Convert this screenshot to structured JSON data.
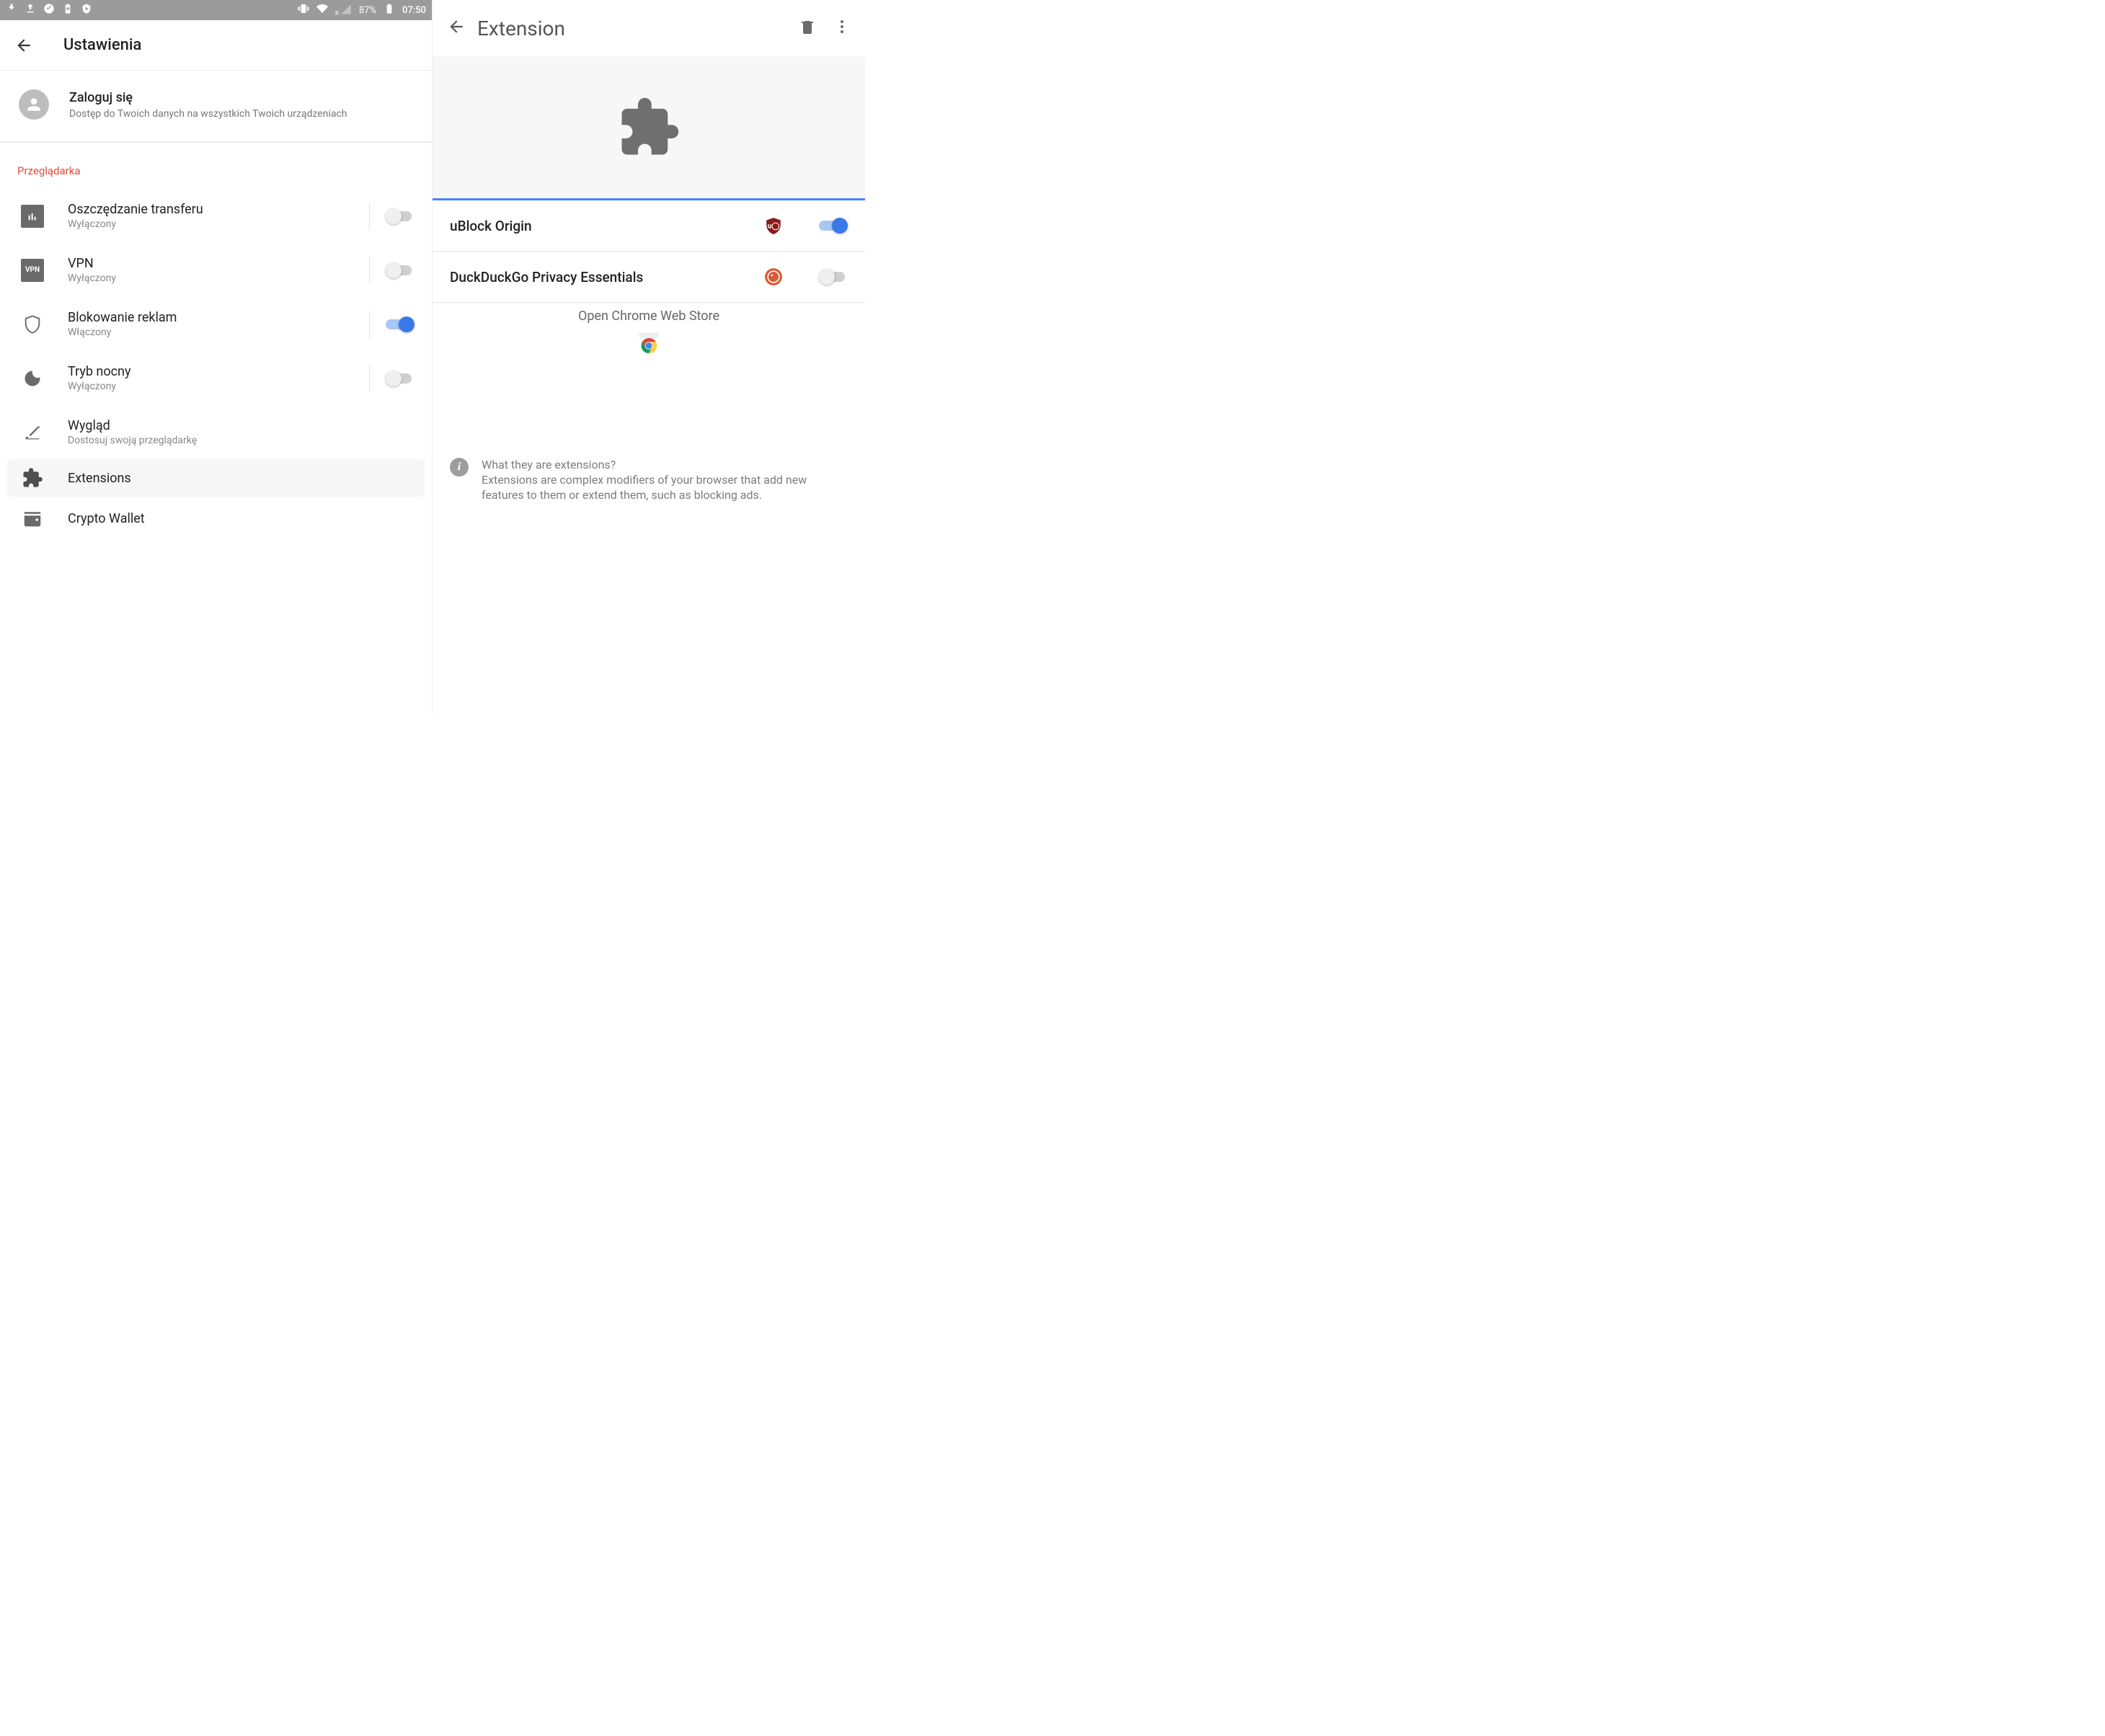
{
  "statusbar": {
    "battery_pct": "87%",
    "time": "07:50"
  },
  "left": {
    "header_title": "Ustawienia",
    "login": {
      "title": "Zaloguj się",
      "subtitle": "Dostęp do Twoich danych na wszystkich Twoich urządzeniach"
    },
    "section_browser": "Przeglądarka",
    "settings": [
      {
        "title": "Oszczędzanie transferu",
        "subtitle": "Wyłączony",
        "toggle": false
      },
      {
        "title": "VPN",
        "subtitle": "Wyłączony",
        "toggle": false
      },
      {
        "title": "Blokowanie reklam",
        "subtitle": "Włączony",
        "toggle": true
      },
      {
        "title": "Tryb nocny",
        "subtitle": "Wyłączony",
        "toggle": false
      },
      {
        "title": "Wygląd",
        "subtitle": "Dostosuj swoją przeglądarkę"
      },
      {
        "title": "Extensions"
      },
      {
        "title": "Crypto Wallet"
      }
    ]
  },
  "right": {
    "header_title": "Extension",
    "extensions": [
      {
        "name": "uBlock Origin",
        "enabled": true
      },
      {
        "name": "DuckDuckGo Privacy Essentials",
        "enabled": false
      }
    ],
    "webstore_label": "Open Chrome Web Store",
    "info_q": "What they are extensions?",
    "info_body": "Extensions are complex modifiers of your browser that add new features to them or extend them, such as blocking ads."
  }
}
